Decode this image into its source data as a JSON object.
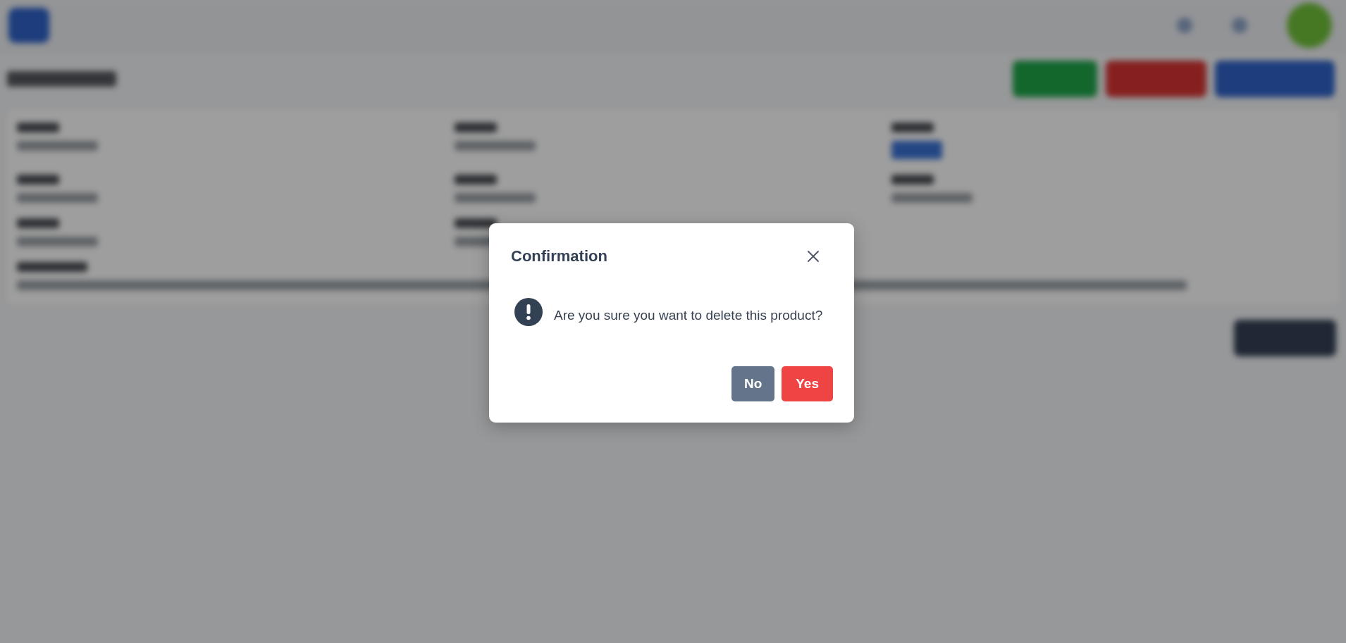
{
  "dialog": {
    "title": "Confirmation",
    "message": "Are you sure you want to delete this product?",
    "buttons": [
      {
        "label": "No",
        "kind": "cancel"
      },
      {
        "label": "Yes",
        "kind": "confirm"
      }
    ]
  }
}
